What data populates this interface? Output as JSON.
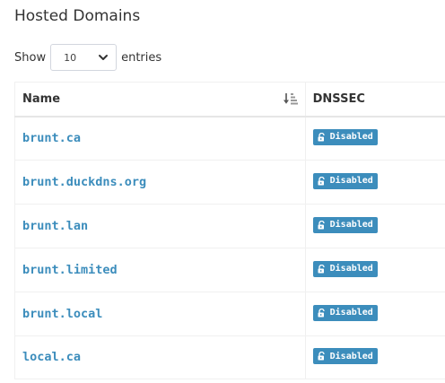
{
  "heading": "Hosted Domains",
  "length_menu": {
    "prefix": "Show",
    "selected": "10",
    "suffix": "entries"
  },
  "table": {
    "columns": [
      {
        "label": "Name",
        "sort_icon": "sort-amount-down-icon"
      },
      {
        "label": "DNSSEC"
      }
    ],
    "rows": [
      {
        "name": "brunt.ca",
        "dnssec": "Disabled"
      },
      {
        "name": "brunt.duckdns.org",
        "dnssec": "Disabled"
      },
      {
        "name": "brunt.lan",
        "dnssec": "Disabled"
      },
      {
        "name": "brunt.limited",
        "dnssec": "Disabled"
      },
      {
        "name": "brunt.local",
        "dnssec": "Disabled"
      },
      {
        "name": "local.ca",
        "dnssec": "Disabled"
      }
    ]
  },
  "colors": {
    "link": "#3c8dbc",
    "badge": "#3c8dbc",
    "text": "#333333",
    "border": "#f0f0f0"
  }
}
